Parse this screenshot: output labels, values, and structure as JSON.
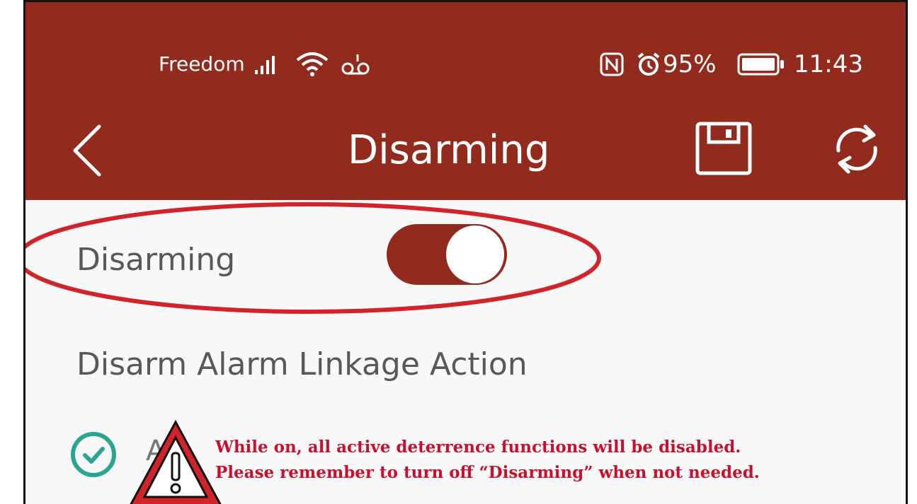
{
  "status_bar": {
    "carrier": "Freedom",
    "battery": "95%",
    "time": "11:43",
    "icons": [
      "signal-icon",
      "wifi-icon",
      "voicemail-icon",
      "nfc-icon",
      "alarm-clock-icon",
      "battery-icon"
    ]
  },
  "header": {
    "title": "Disarming",
    "back_icon": "chevron-left-icon",
    "save_icon": "floppy-disk-icon",
    "refresh_icon": "refresh-icon",
    "color": "#922a1e"
  },
  "settings": {
    "disarming_label": "Disarming",
    "disarming_enabled": true,
    "section_title": "Disarm Alarm Linkage Action",
    "first_item_partial": "A"
  },
  "annotation": {
    "line1": "While on, all active deterrence functions will be disabled.",
    "line2": "Please remember to turn off “Disarming” when not needed.",
    "color": "#c8102e"
  }
}
